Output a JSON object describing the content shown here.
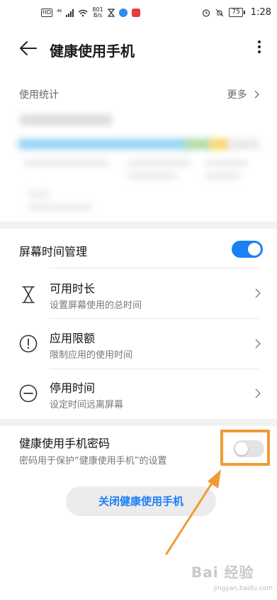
{
  "status_bar": {
    "hd": "HD",
    "signal_gen": "⁴⁶",
    "net_speed_value": "801",
    "net_speed_unit": "B/s",
    "battery": "75",
    "time": "1:28"
  },
  "app_bar": {
    "title": "健康使用手机"
  },
  "usage_stats": {
    "header": "使用统计",
    "more_label": "更多"
  },
  "screen_time": {
    "label": "屏幕时间管理",
    "enabled": true
  },
  "settings": [
    {
      "label": "可用时长",
      "subtitle": "设置屏幕使用的总时间",
      "icon": "hourglass-icon"
    },
    {
      "label": "应用限额",
      "subtitle": "限制应用的使用时间",
      "icon": "exclamation-circle-icon"
    },
    {
      "label": "停用时间",
      "subtitle": "设定时间远离屏幕",
      "icon": "minus-circle-icon"
    }
  ],
  "password": {
    "label": "健康使用手机密码",
    "subtitle": "密码用于保护“健康使用手机”的设置",
    "enabled": false
  },
  "close_button": {
    "label": "关闭健康使用手机"
  },
  "watermark": {
    "text": "Bai 经验",
    "subtext": "jingyan.baidu.com"
  },
  "colors": {
    "accent": "#1b7ff5",
    "annotation": "#f09a36"
  }
}
